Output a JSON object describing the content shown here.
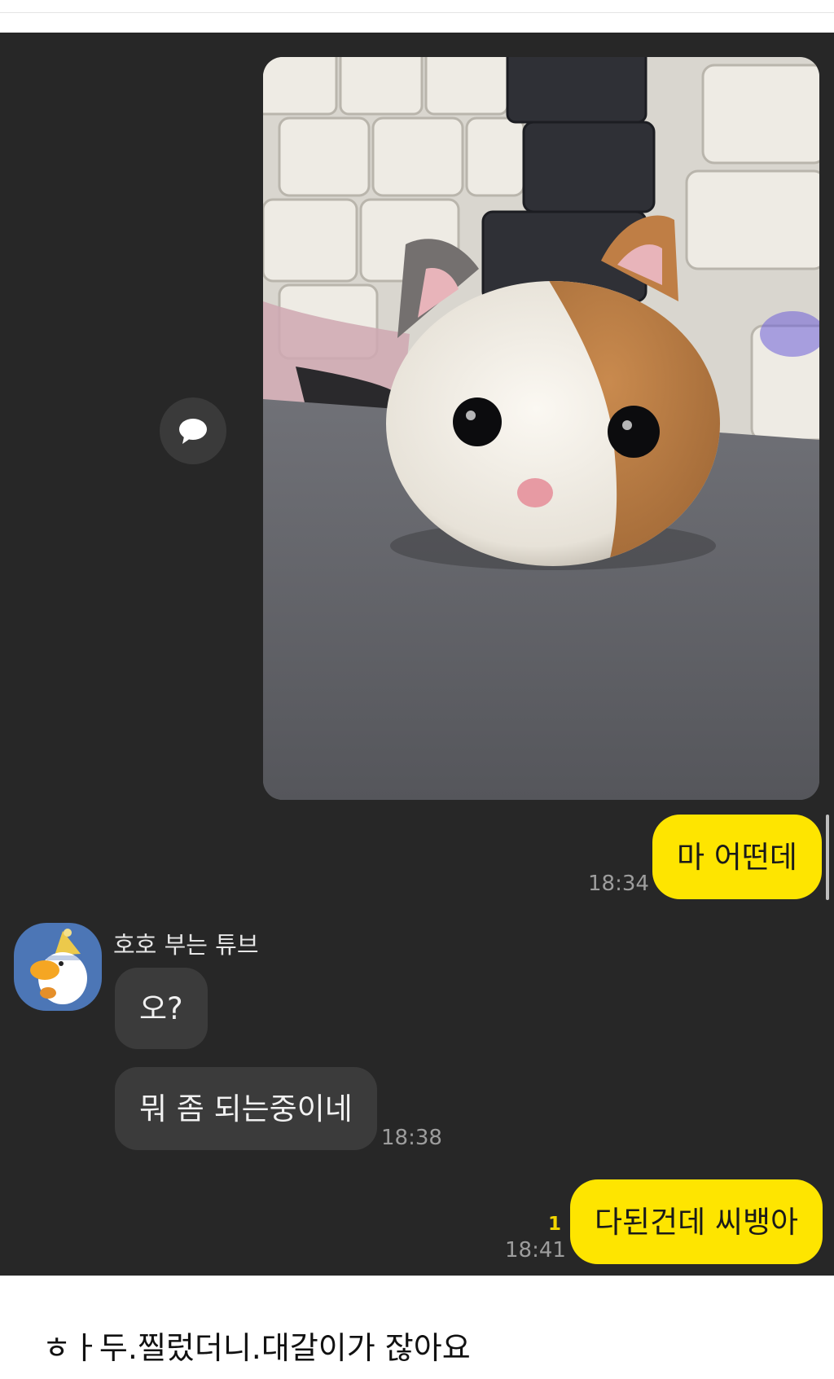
{
  "chat": {
    "messages": {
      "photo_message": {
        "image_description": "needle-felted calico cat head in front of a keyboard",
        "icon": "speech-bubble-icon"
      },
      "msg1": {
        "text": "마 어떤데",
        "time": "18:34"
      },
      "sender": {
        "name": "호호 부는 튜브",
        "avatar_icon": "duck-character-avatar"
      },
      "msg2": {
        "text": "오?"
      },
      "msg3": {
        "text": "뭐 좀 되는중이네",
        "time": "18:38"
      },
      "msg4": {
        "text": "다된건데 씨뱅아",
        "time": "18:41",
        "unread_count": "1"
      }
    },
    "colors": {
      "background": "#272727",
      "my_bubble": "#fee500",
      "their_bubble": "#3b3b3b",
      "unread": "#f2d500"
    }
  },
  "caption": "ㅎㅏ두.찔렀더니.대갈이가 잖아요"
}
